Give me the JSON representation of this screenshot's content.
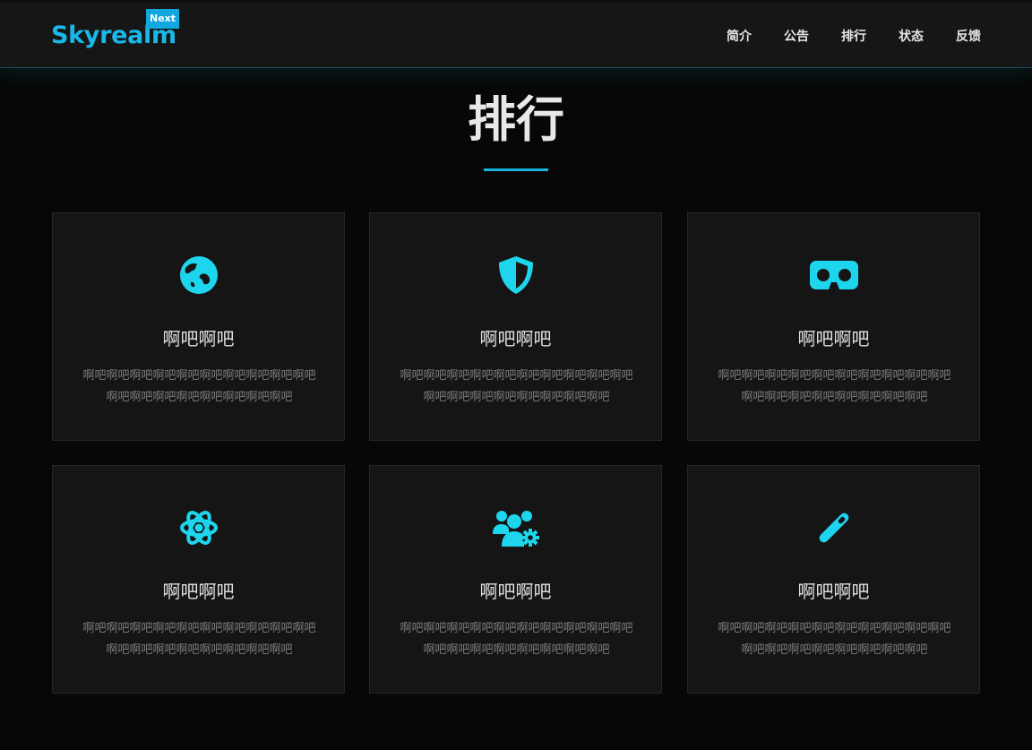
{
  "header": {
    "brand": "Skyrealm",
    "badge": "Next",
    "nav": [
      "简介",
      "公告",
      "排行",
      "状态",
      "反馈"
    ]
  },
  "section": {
    "title": "排行"
  },
  "colors": {
    "accent": "#13b5dc",
    "icon": "#1dd6ee",
    "brand": "#19b8e8"
  },
  "cards": [
    {
      "icon": "globe-icon",
      "title": "啊吧啊吧",
      "desc": "啊吧啊吧啊吧啊吧啊吧啊吧啊吧啊吧啊吧啊吧啊吧啊吧啊吧啊吧啊吧啊吧啊吧啊吧"
    },
    {
      "icon": "shield-icon",
      "title": "啊吧啊吧",
      "desc": "啊吧啊吧啊吧啊吧啊吧啊吧啊吧啊吧啊吧啊吧啊吧啊吧啊吧啊吧啊吧啊吧啊吧啊吧"
    },
    {
      "icon": "vr-headset-icon",
      "title": "啊吧啊吧",
      "desc": "啊吧啊吧啊吧啊吧啊吧啊吧啊吧啊吧啊吧啊吧啊吧啊吧啊吧啊吧啊吧啊吧啊吧啊吧"
    },
    {
      "icon": "atom-icon",
      "title": "啊吧啊吧",
      "desc": "啊吧啊吧啊吧啊吧啊吧啊吧啊吧啊吧啊吧啊吧啊吧啊吧啊吧啊吧啊吧啊吧啊吧啊吧"
    },
    {
      "icon": "users-gear-icon",
      "title": "啊吧啊吧",
      "desc": "啊吧啊吧啊吧啊吧啊吧啊吧啊吧啊吧啊吧啊吧啊吧啊吧啊吧啊吧啊吧啊吧啊吧啊吧"
    },
    {
      "icon": "pen-icon",
      "title": "啊吧啊吧",
      "desc": "啊吧啊吧啊吧啊吧啊吧啊吧啊吧啊吧啊吧啊吧啊吧啊吧啊吧啊吧啊吧啊吧啊吧啊吧"
    }
  ]
}
